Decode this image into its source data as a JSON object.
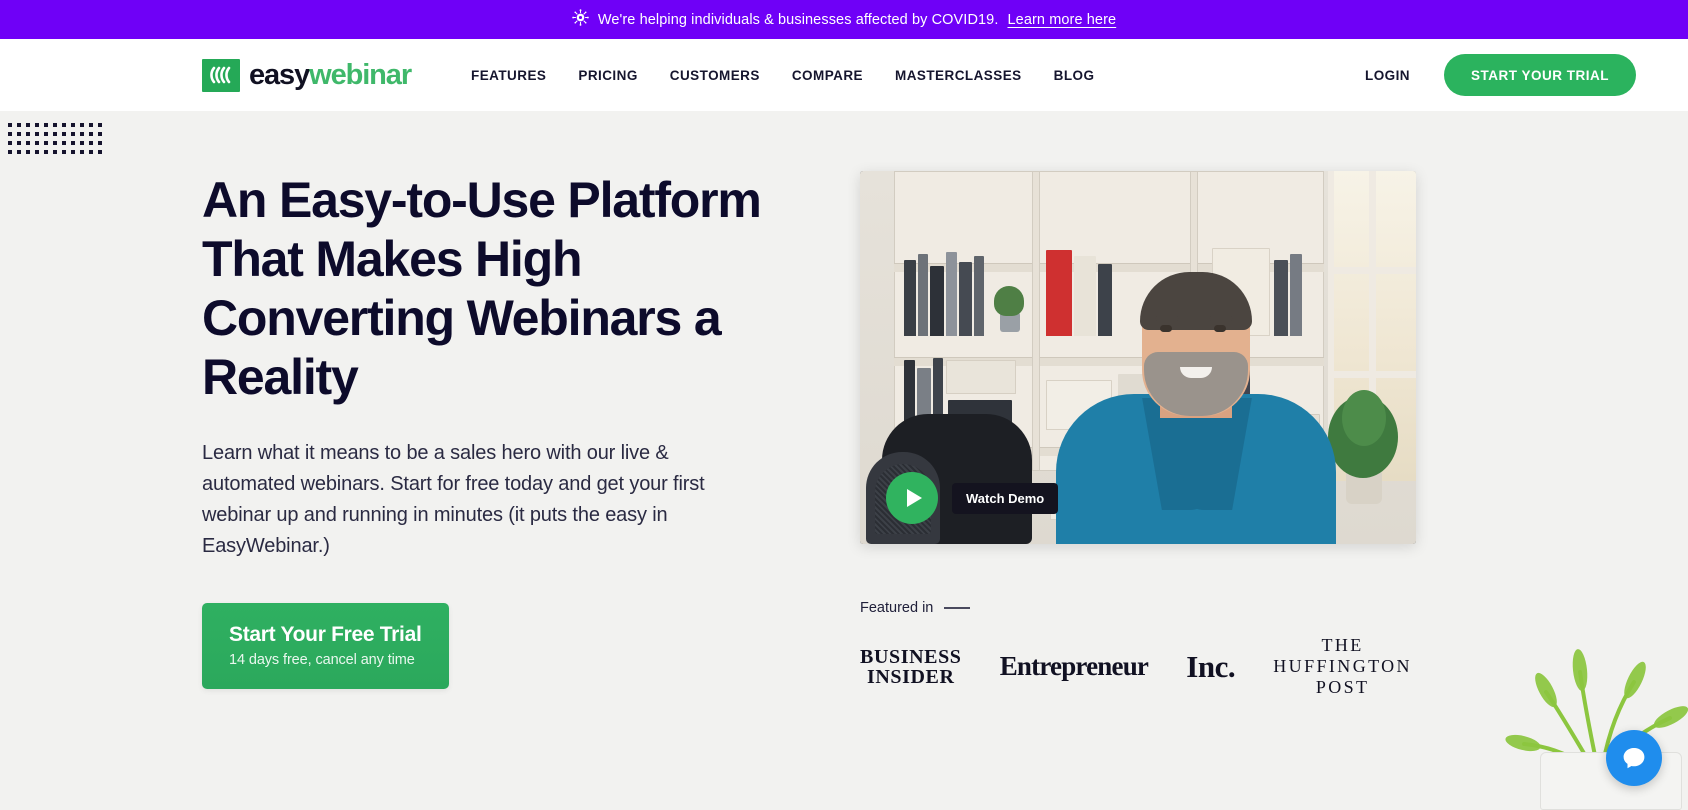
{
  "banner": {
    "icon": "virus-icon",
    "text": "We're helping individuals & businesses affected by COVID19.",
    "link_label": "Learn more here",
    "background": "#6f00f7",
    "text_color": "#ffffff"
  },
  "header": {
    "logo": {
      "icon": "easywebinar-logo-icon",
      "word_primary": "easy",
      "word_secondary": "webinar",
      "primary_color": "#111122",
      "secondary_color": "#3fb86a",
      "mark_color": "#25a957"
    },
    "nav": [
      {
        "label": "FEATURES"
      },
      {
        "label": "PRICING"
      },
      {
        "label": "CUSTOMERS"
      },
      {
        "label": "COMPARE"
      },
      {
        "label": "MASTERCLASSES"
      },
      {
        "label": "BLOG"
      }
    ],
    "login_label": "LOGIN",
    "trial_button_label": "START YOUR TRIAL",
    "trial_button_color": "#2bb35e"
  },
  "hero": {
    "title": "An Easy-to-Use Platform That Makes High Converting Webinars a Reality",
    "subtitle": "Learn what it means to be a sales hero with our live & automated webinars. Start for free today and get your first webinar up and running in minutes (it puts the easy in EasyWebinar.)",
    "cta": {
      "main_label": "Start Your Free Trial",
      "sub_label": "14 days free, cancel any time",
      "color": "#2fb061"
    },
    "title_color": "#0d0b2b",
    "background": "#f2f2f0"
  },
  "video": {
    "play_button_label": "play-button",
    "watch_chip_label": "Watch Demo",
    "play_button_color": "#30b35f",
    "chip_background": "#14131f"
  },
  "featured": {
    "label": "Featured in",
    "logos": [
      {
        "name": "business-insider",
        "line1": "BUSINESS",
        "line2": "INSIDER"
      },
      {
        "name": "entrepreneur",
        "line1": "Entrepreneur",
        "line2": ""
      },
      {
        "name": "inc",
        "line1": "Inc.",
        "line2": ""
      },
      {
        "name": "huffington-post",
        "line1": "THE",
        "line2": "HUFFINGTON",
        "line3": "POST"
      }
    ]
  },
  "chat": {
    "icon": "chat-bubble-icon",
    "color": "#1f8ded"
  }
}
